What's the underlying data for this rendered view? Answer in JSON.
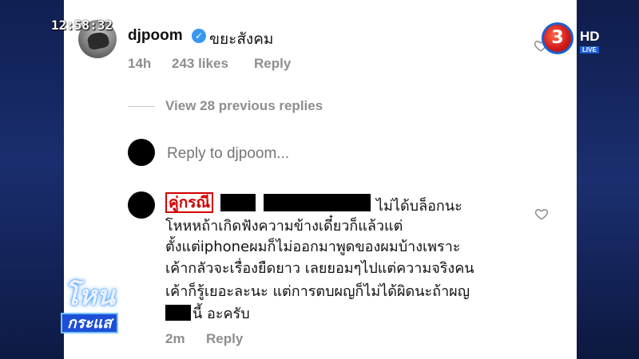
{
  "overlay": {
    "clock": "12:58:32",
    "channel_logo": "3",
    "hd_label": "HD",
    "live_label": "LIVE",
    "show_logo_line1": "โหน",
    "show_logo_line2": "กระแส"
  },
  "comment1": {
    "username": "djpoom",
    "text": "ขยะสังคม",
    "time": "14h",
    "likes": "243 likes",
    "reply_label": "Reply"
  },
  "view_replies": "View 28 previous replies",
  "reply_box": {
    "placeholder": "Reply to djpoom..."
  },
  "comment2": {
    "name": "คู่กรณี",
    "lines": [
      "ไม่ได้บล็อกนะ",
      "โหหหถ้าเกิดฟังความข้างเดี๋ยวก็แล้วแต่",
      "ตั้งแต่iphoneผมก็ไม่ออกมาพูดของผมบ้างเพราะ",
      "เค้ากลัวจะเรื่องยืดยาว เลยยอมๆไปแต่ความจริงคน",
      "เค้าก็รู้เยอะละนะ แต่การตบผญก็ไม่ได้ผิดนะถ้าผญ",
      "นี้ อะครับ"
    ],
    "time": "2m",
    "reply_label": "Reply"
  },
  "icons": {
    "verified": "verified-badge-icon",
    "like": "heart-icon"
  },
  "colors": {
    "verified": "#3897f0",
    "meta": "#8e8e8e",
    "highlight": "#d40000"
  }
}
